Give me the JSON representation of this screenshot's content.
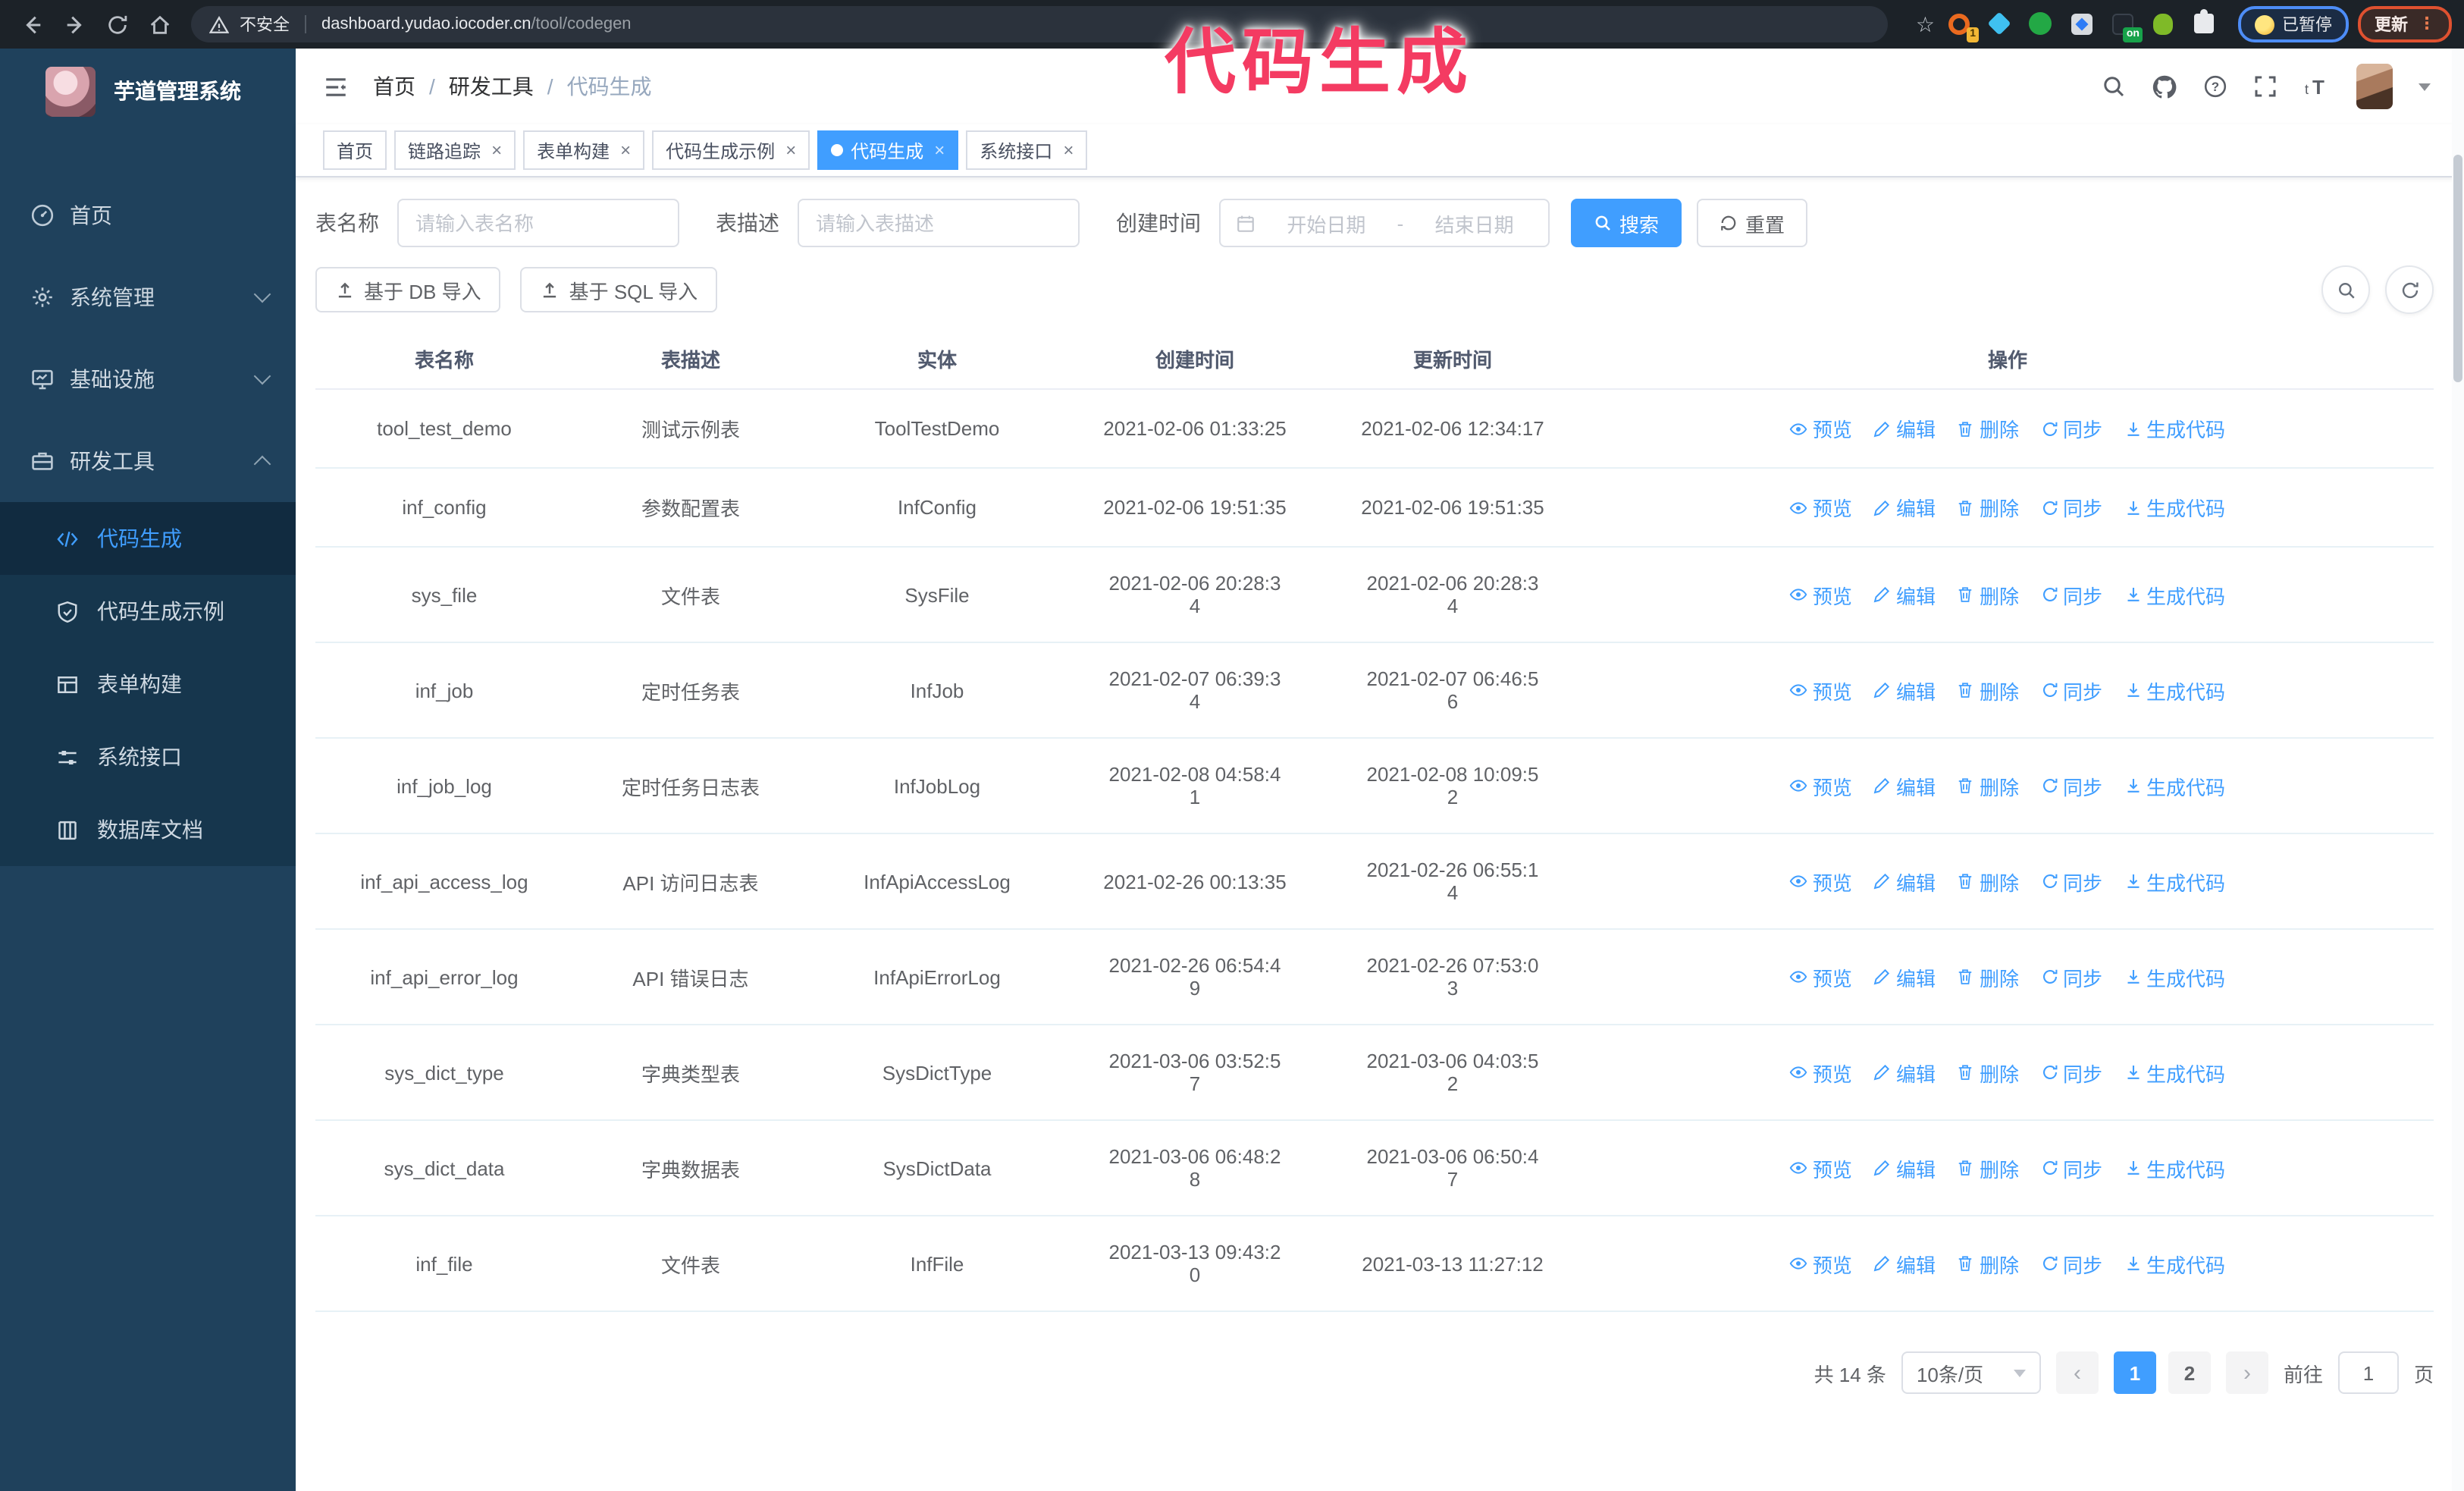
{
  "browser": {
    "security_label": "不安全",
    "url_host": "dashboard.yudao.iocoder.cn",
    "url_path": "/tool/codegen",
    "paused_label": "已暂停",
    "update_label": "更新",
    "extensions": [
      {
        "name": "orange-extension-icon",
        "badge": "1"
      },
      {
        "name": "gem-extension-icon"
      },
      {
        "name": "check-extension-icon"
      },
      {
        "name": "grid-extension-icon"
      },
      {
        "name": "dark-extension-icon",
        "badge": "on"
      },
      {
        "name": "green-extension-icon"
      },
      {
        "name": "puzzle-extension-icon"
      }
    ]
  },
  "annotation": {
    "text": "代码生成"
  },
  "sidebar": {
    "app_title": "芋道管理系统",
    "items": [
      {
        "label": "首页",
        "icon": "dashboard-icon"
      },
      {
        "label": "系统管理",
        "icon": "gear-icon",
        "chevron": "down"
      },
      {
        "label": "基础设施",
        "icon": "monitor-icon",
        "chevron": "down"
      },
      {
        "label": "研发工具",
        "icon": "toolbox-icon",
        "chevron": "up"
      }
    ],
    "subitems": [
      {
        "label": "代码生成",
        "icon": "code-icon",
        "active": true
      },
      {
        "label": "代码生成示例",
        "icon": "shield-check-icon"
      },
      {
        "label": "表单构建",
        "icon": "form-icon"
      },
      {
        "label": "系统接口",
        "icon": "sliders-icon"
      },
      {
        "label": "数据库文档",
        "icon": "database-icon"
      }
    ]
  },
  "header": {
    "breadcrumb": [
      "首页",
      "研发工具",
      "代码生成"
    ]
  },
  "tabs": [
    {
      "label": "首页",
      "closable": false,
      "active": false
    },
    {
      "label": "链路追踪",
      "closable": true,
      "active": false
    },
    {
      "label": "表单构建",
      "closable": true,
      "active": false
    },
    {
      "label": "代码生成示例",
      "closable": true,
      "active": false
    },
    {
      "label": "代码生成",
      "closable": true,
      "active": true
    },
    {
      "label": "系统接口",
      "closable": true,
      "active": false
    }
  ],
  "filters": {
    "table_name_label": "表名称",
    "table_name_placeholder": "请输入表名称",
    "table_desc_label": "表描述",
    "table_desc_placeholder": "请输入表描述",
    "create_time_label": "创建时间",
    "start_placeholder": "开始日期",
    "range_separator": "-",
    "end_placeholder": "结束日期",
    "search_label": "搜索",
    "reset_label": "重置",
    "import_db_label": "基于 DB 导入",
    "import_sql_label": "基于 SQL 导入"
  },
  "table": {
    "columns": [
      "表名称",
      "表描述",
      "实体",
      "创建时间",
      "更新时间",
      "操作"
    ],
    "action_labels": [
      "预览",
      "编辑",
      "删除",
      "同步",
      "生成代码"
    ],
    "action_icons": [
      "eye-icon",
      "edit-icon",
      "trash-icon",
      "sync-icon",
      "download-icon"
    ],
    "rows": [
      {
        "name": "tool_test_demo",
        "desc": "测试示例表",
        "entity": "ToolTestDemo",
        "created": "2021-02-06 01:33:25",
        "updated": "2021-02-06 12:34:17"
      },
      {
        "name": "inf_config",
        "desc": "参数配置表",
        "entity": "InfConfig",
        "created": "2021-02-06 19:51:35",
        "updated": "2021-02-06 19:51:35"
      },
      {
        "name": "sys_file",
        "desc": "文件表",
        "entity": "SysFile",
        "created": "2021-02-06 20:28:3\n4",
        "updated": "2021-02-06 20:28:3\n4"
      },
      {
        "name": "inf_job",
        "desc": "定时任务表",
        "entity": "InfJob",
        "created": "2021-02-07 06:39:3\n4",
        "updated": "2021-02-07 06:46:5\n6"
      },
      {
        "name": "inf_job_log",
        "desc": "定时任务日志表",
        "entity": "InfJobLog",
        "created": "2021-02-08 04:58:4\n1",
        "updated": "2021-02-08 10:09:5\n2"
      },
      {
        "name": "inf_api_access_log",
        "desc": "API 访问日志表",
        "entity": "InfApiAccessLog",
        "created": "2021-02-26 00:13:35",
        "updated": "2021-02-26 06:55:1\n4"
      },
      {
        "name": "inf_api_error_log",
        "desc": "API 错误日志",
        "entity": "InfApiErrorLog",
        "created": "2021-02-26 06:54:4\n9",
        "updated": "2021-02-26 07:53:0\n3"
      },
      {
        "name": "sys_dict_type",
        "desc": "字典类型表",
        "entity": "SysDictType",
        "created": "2021-03-06 03:52:5\n7",
        "updated": "2021-03-06 04:03:5\n2"
      },
      {
        "name": "sys_dict_data",
        "desc": "字典数据表",
        "entity": "SysDictData",
        "created": "2021-03-06 06:48:2\n8",
        "updated": "2021-03-06 06:50:4\n7"
      },
      {
        "name": "inf_file",
        "desc": "文件表",
        "entity": "InfFile",
        "created": "2021-03-13 09:43:2\n0",
        "updated": "2021-03-13 11:27:12"
      }
    ]
  },
  "pagination": {
    "total_label": "共 14 条",
    "page_size_label": "10条/页",
    "prev_label": "‹",
    "next_label": "›",
    "pages": [
      "1",
      "2"
    ],
    "active_page": "1",
    "goto_label": "前往",
    "goto_value": "1",
    "page_unit_label": "页"
  },
  "colors": {
    "primary": "#409eff",
    "sidebar_bg": "#1f415c",
    "submenu_bg": "#16364d",
    "annotation_pink": "#f43b62",
    "chrome_bg": "#1c2228"
  }
}
